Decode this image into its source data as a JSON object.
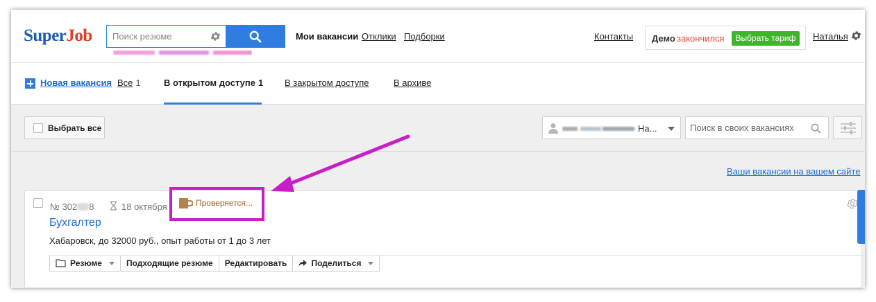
{
  "header": {
    "logo": {
      "part1": "Super",
      "part2": "Job"
    },
    "search": {
      "placeholder": "Поиск резюме"
    },
    "nav": {
      "my_vacancies": "Мои вакансии",
      "responses": "Отклики",
      "collections": "Подборки"
    },
    "contacts": "Контакты",
    "demo": {
      "label": "Демо",
      "status": "закончился",
      "button": "Выбрать тариф"
    },
    "user_name": "Наталья"
  },
  "tabs": {
    "new_vacancy": "Новая вакансия",
    "all": {
      "label": "Все",
      "count": "1"
    },
    "open": {
      "label": "В открытом доступе",
      "count": "1"
    },
    "closed": "В закрытом доступе",
    "archive": "В архиве"
  },
  "toolbar": {
    "select_all": "Выбрать все",
    "user_filter": "На...",
    "vacancy_search": {
      "placeholder": "Поиск в своих вакансиях"
    },
    "site_link": "Ваши вакансии на вашем сайте"
  },
  "vacancy": {
    "number_prefix": "№ 302",
    "number_suffix": "8",
    "date": "18 октября",
    "status": "Проверяется...",
    "title": "Бухгалтер",
    "info": "Хабаровск, до 32000 руб., опыт работы от 1 до 3 лет",
    "actions": {
      "resumes": "Резюме",
      "matching": "Подходящие резюме",
      "edit": "Редактировать",
      "share": "Поделиться"
    }
  },
  "colors": {
    "brand_blue": "#2f7de1",
    "logo_red": "#e03c25",
    "tariff_green": "#3db729",
    "highlight_magenta": "#c81ec8"
  }
}
